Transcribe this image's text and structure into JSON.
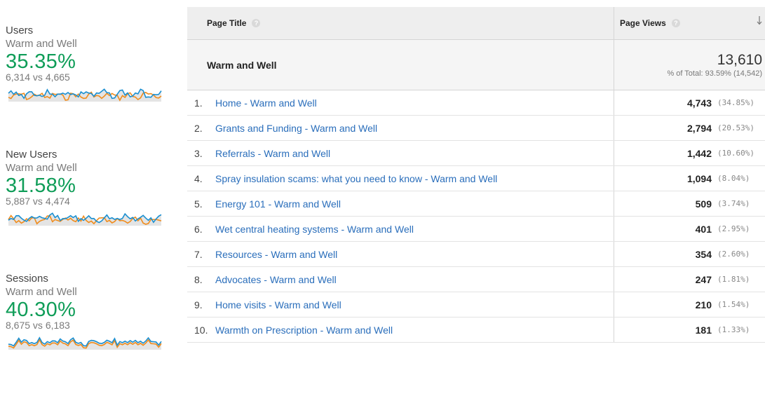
{
  "metrics": [
    {
      "name": "Users",
      "segment": "Warm and Well",
      "change": "35.35%",
      "compare": "6,314 vs 4,665"
    },
    {
      "name": "New Users",
      "segment": "Warm and Well",
      "change": "31.58%",
      "compare": "5,887 vs 4,474"
    },
    {
      "name": "Sessions",
      "segment": "Warm and Well",
      "change": "40.30%",
      "compare": "8,675 vs 6,183"
    }
  ],
  "colors": {
    "positive": "#0f9d58",
    "link": "#2a6ebb",
    "spark_current": "#1a8fd1",
    "spark_previous": "#f08c1c"
  },
  "table": {
    "header": {
      "page_title": "Page Title",
      "page_views": "Page Views",
      "help": "?"
    },
    "total": {
      "label": "Warm and Well",
      "value": "13,610",
      "sub": "% of Total: 93.59% (14,542)"
    },
    "rows": [
      {
        "rank": "1.",
        "title": "Home - Warm and Well",
        "views": "4,743",
        "pct": "(34.85%)"
      },
      {
        "rank": "2.",
        "title": "Grants and Funding - Warm and Well",
        "views": "2,794",
        "pct": "(20.53%)"
      },
      {
        "rank": "3.",
        "title": "Referrals - Warm and Well",
        "views": "1,442",
        "pct": "(10.60%)"
      },
      {
        "rank": "4.",
        "title": "Spray insulation scams: what you need to know - Warm and Well",
        "views": "1,094",
        "pct": "(8.04%)"
      },
      {
        "rank": "5.",
        "title": "Energy 101 - Warm and Well",
        "views": "509",
        "pct": "(3.74%)"
      },
      {
        "rank": "6.",
        "title": "Wet central heating systems - Warm and Well",
        "views": "401",
        "pct": "(2.95%)"
      },
      {
        "rank": "7.",
        "title": "Resources - Warm and Well",
        "views": "354",
        "pct": "(2.60%)"
      },
      {
        "rank": "8.",
        "title": "Advocates - Warm and Well",
        "views": "247",
        "pct": "(1.81%)"
      },
      {
        "rank": "9.",
        "title": "Home visits - Warm and Well",
        "views": "210",
        "pct": "(1.54%)"
      },
      {
        "rank": "10.",
        "title": "Warmth on Prescription - Warm and Well",
        "views": "181",
        "pct": "(1.33%)"
      }
    ]
  }
}
